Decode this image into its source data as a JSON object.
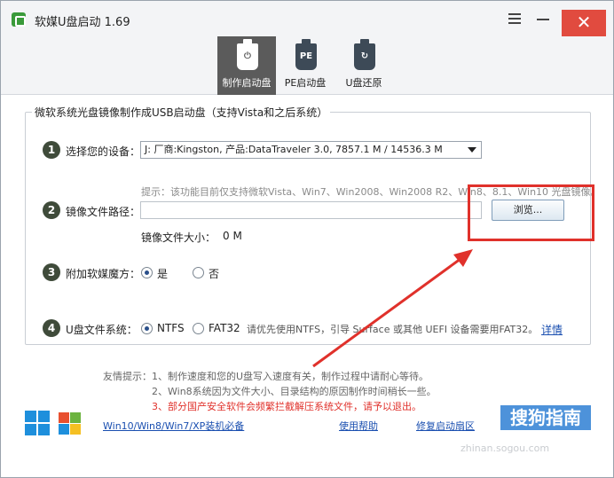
{
  "window": {
    "title": "软媒U盘启动 1.69",
    "close_glyph": "✕"
  },
  "tabs": [
    {
      "label": "制作启动盘",
      "glyph": "⏻",
      "icon": "usb-power-icon",
      "active": true
    },
    {
      "label": "PE启动盘",
      "glyph": "PE",
      "icon": "usb-pe-icon",
      "active": false
    },
    {
      "label": "U盘还原",
      "glyph": "↻",
      "icon": "usb-restore-icon",
      "active": false
    }
  ],
  "group": {
    "legend": "微软系统光盘镜像制作成USB启动盘（支持Vista和之后系统）"
  },
  "steps": {
    "s1": {
      "num": "1",
      "label": "选择您的设备："
    },
    "s2": {
      "num": "2",
      "label": "镜像文件路径："
    },
    "s3": {
      "num": "3",
      "label": "附加软媒魔方："
    },
    "s4": {
      "num": "4",
      "label": "U盘文件系统："
    }
  },
  "device": {
    "selected": "J: 厂商:Kingston, 产品:DataTraveler 3.0,  7857.1 M / 14536.3 M"
  },
  "image": {
    "hint": "提示：该功能目前仅支持微软Vista、Win7、Win2008、Win2008 R2、Win8、8.1、Win10 光盘镜像。",
    "path_value": "",
    "browse_label": "浏览...",
    "size_label": "镜像文件大小：",
    "size_value": "0 M"
  },
  "mofang": {
    "yes": "是",
    "no": "否",
    "selected": "yes"
  },
  "filesystem": {
    "ntfs": "NTFS",
    "fat32": "FAT32",
    "selected": "NTFS",
    "note": "请优先使用NTFS，引导 Surface 或其他 UEFI 设备需要用FAT32。",
    "detail_link": "详情"
  },
  "tips": {
    "line1": "友情提示：1、制作速度和您的U盘写入速度有关，制作过程中请耐心等待。",
    "line2": "2、Win8系统因为文件大小、目录结构的原因制作时间稍长一些。",
    "line3": "3、部分国产安全软件会频繁拦截解压系统文件，请予以退出。"
  },
  "bottom": {
    "link1": "Win10/Win8/Win7/XP装机必备",
    "link2": "使用帮助",
    "link3": "修复启动扇区"
  },
  "watermark": {
    "text": "搜狗指南",
    "sub": "zhinan.sogou.com"
  },
  "colors": {
    "accent_red": "#e0312b",
    "active_tab": "#5b5b5b",
    "link_blue": "#1a4fb0"
  }
}
